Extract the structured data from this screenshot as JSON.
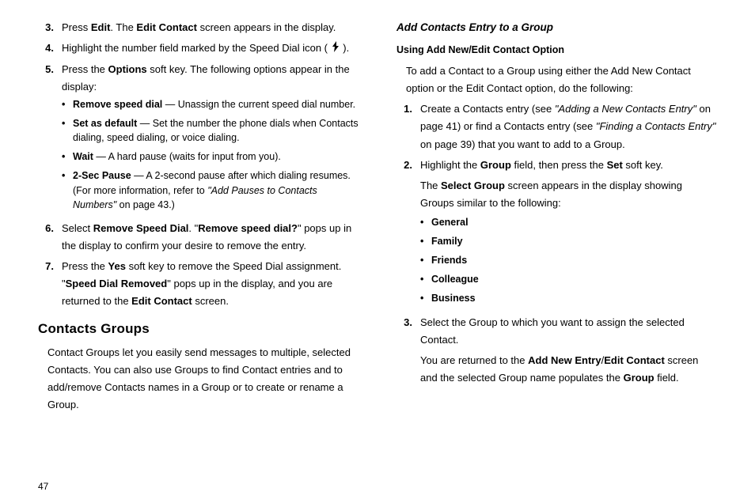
{
  "pageNumber": "47",
  "left": {
    "step3": {
      "num": "3.",
      "a": "Press ",
      "b1": "Edit",
      "b": ". The ",
      "b2": "Edit Contact",
      "c": " screen appears in the display."
    },
    "step4": {
      "num": "4.",
      "a": "Highlight the number field marked by the Speed Dial icon ( ",
      "b": " )."
    },
    "step5": {
      "num": "5.",
      "a": "Press the ",
      "b1": "Options",
      "b": " soft key. The following options appear in the display:",
      "bullets": {
        "b1": {
          "t1": "Remove speed dial",
          "t2": " — Unassign the current speed dial number."
        },
        "b2": {
          "t1": "Set as default",
          "t2": " — Set the number the phone dials when Contacts dialing, speed dialing, or voice dialing."
        },
        "b3": {
          "t1": "Wait",
          "t2": " — A hard pause (waits for input from you)."
        },
        "b4": {
          "t1": "2-Sec Pause",
          "t2": " — A 2-second pause after which dialing resumes. (For more information, refer to ",
          "ref": "\"Add Pauses to Contacts Numbers\"",
          "t3": "  on page 43.)"
        }
      }
    },
    "step6": {
      "num": "6.",
      "a": "Select ",
      "b1": "Remove Speed Dial",
      "b": ". \"",
      "b2": "Remove speed dial?",
      "c": "\" pops up in the display to confirm your desire to remove the entry."
    },
    "step7": {
      "num": "7.",
      "a": "Press the ",
      "b1": "Yes",
      "b": " soft key to remove the Speed Dial assignment. \"",
      "b2": "Speed Dial Removed",
      "c": "\" pops up in the display, and you are returned to the ",
      "b3": "Edit Contact",
      "d": " screen."
    },
    "groupsHeading": "Contacts Groups",
    "groupsPara": "Contact Groups let you easily send messages to multiple, selected Contacts. You can also use Groups to find Contact entries and to add/remove Contacts names in a Group or to create or rename a Group."
  },
  "right": {
    "h1": "Add Contacts Entry to a Group",
    "h2": "Using Add New/Edit Contact Option",
    "intro": "To add a Contact to a Group using either the Add New Contact option or the Edit Contact option, do the following:",
    "step1": {
      "num": "1.",
      "a": "Create a Contacts entry (see ",
      "ref1": "\"Adding a New Contacts Entry\"",
      "b": " on page 41) or find a Contacts entry (see ",
      "ref2": "\"Finding a Contacts Entry\"",
      "c": " on page 39) that you want to add to a Group."
    },
    "step2": {
      "num": "2.",
      "a": "Highlight the ",
      "b1": "Group",
      "b": " field, then press the ",
      "b2": "Set",
      "c": " soft key.",
      "para2a": "The ",
      "para2b": "Select Group",
      "para2c": " screen appears in the display showing Groups similar to the following:",
      "bullets": {
        "b1": "General",
        "b2": "Family",
        "b3": "Friends",
        "b4": "Colleague",
        "b5": "Business"
      }
    },
    "step3": {
      "num": "3.",
      "a": "Select the Group to which you want to assign the selected Contact.",
      "para2a": "You are returned to the ",
      "para2b1": "Add New Entry",
      "para2slash": "/",
      "para2b2": "Edit Contact",
      "para2c": " screen and the selected Group name populates the ",
      "para2b3": "Group",
      "para2d": " field."
    }
  }
}
